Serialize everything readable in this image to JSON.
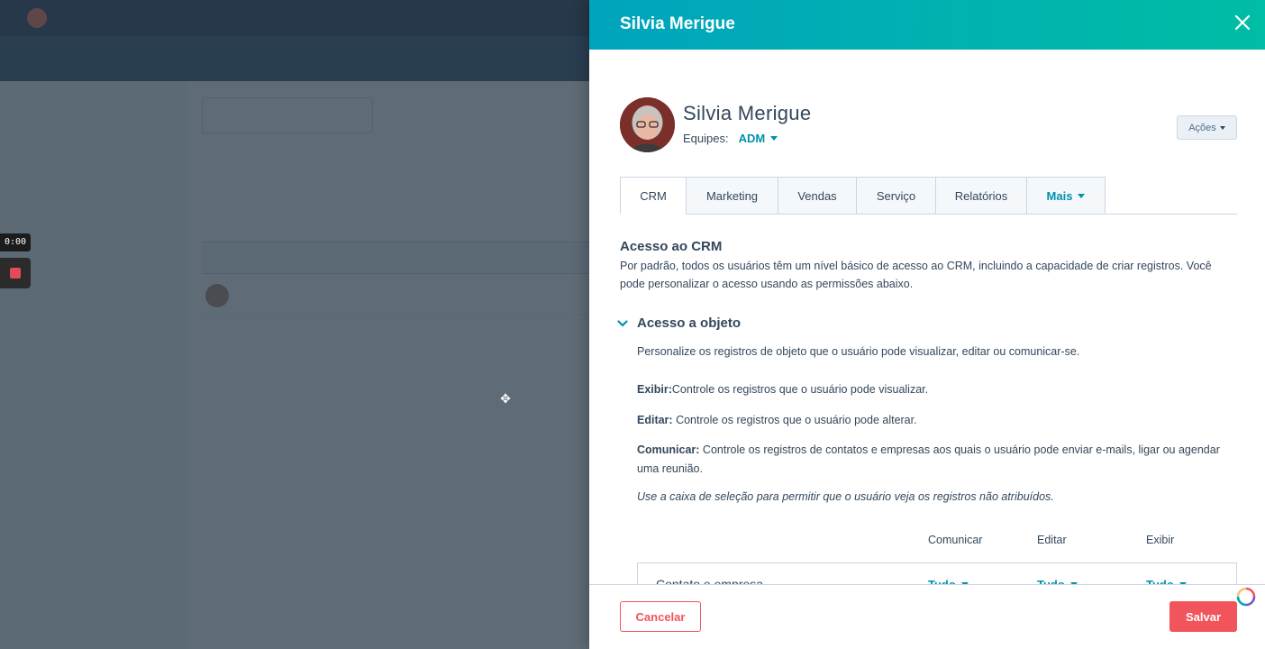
{
  "background": {
    "nav_items": [
      "",
      "",
      "",
      "",
      "",
      "",
      "",
      ""
    ],
    "sidebar_items": [
      "",
      "",
      "",
      "",
      "",
      "",
      "",
      "",
      "",
      ""
    ]
  },
  "recorder": {
    "time": "0:00"
  },
  "panel": {
    "title": "Silvia Merigue",
    "user": {
      "name": "Silvia Merigue",
      "teams_label": "Equipes:",
      "team": "ADM"
    },
    "actions_label": "Ações",
    "tabs": [
      {
        "label": "CRM",
        "active": true
      },
      {
        "label": "Marketing"
      },
      {
        "label": "Vendas"
      },
      {
        "label": "Serviço"
      },
      {
        "label": "Relatórios"
      },
      {
        "label": "Mais"
      }
    ],
    "crm": {
      "title": "Acesso ao CRM",
      "description": "Por padrão, todos os usuários têm um nível básico de acesso ao CRM, incluindo a capacidade de criar registros. Você pode personalizar o acesso usando as permissões abaixo."
    },
    "object_access": {
      "title": "Acesso a objeto",
      "description": "Personalize os registros de objeto que o usuário pode visualizar, editar ou comunicar-se.",
      "view_label": "Exibir:",
      "view_text": "Controle os registros que o usuário pode visualizar.",
      "edit_label": "Editar:",
      "edit_text": " Controle os registros que o usuário pode alterar.",
      "comm_label": "Comunicar:",
      "comm_text": " Controle os registros de contatos e empresas aos quais o usuário pode enviar e-mails, ligar ou agendar uma reunião.",
      "note": "Use a caixa de seleção para permitir que o usuário veja os registros não atribuídos.",
      "columns": [
        "Comunicar",
        "Editar",
        "Exibir"
      ],
      "row": {
        "name": "Contato e empresa",
        "communicate": "Tudo",
        "edit": "Tudo",
        "view": "Tudo"
      }
    },
    "footer": {
      "cancel": "Cancelar",
      "save": "Salvar"
    }
  },
  "colors": {
    "header_start": "#00a4bd",
    "header_end": "#00bda5",
    "link": "#0091ae",
    "danger": "#f2545b",
    "text": "#33475b"
  }
}
